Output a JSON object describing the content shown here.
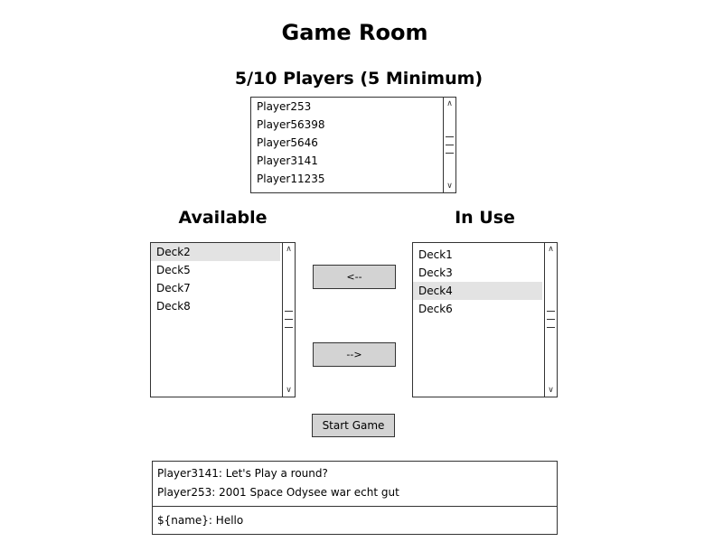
{
  "title": "Game Room",
  "players": {
    "heading": "5/10 Players (5 Minimum)",
    "items": [
      "Player253",
      "Player56398",
      "Player5646",
      "Player3141",
      "Player11235"
    ]
  },
  "available": {
    "heading": "Available",
    "items": [
      "Deck2",
      "Deck5",
      "Deck7",
      "Deck8"
    ],
    "selected": "Deck2"
  },
  "in_use": {
    "heading": "In Use",
    "items": [
      "Deck1",
      "Deck3",
      "Deck4",
      "Deck6"
    ],
    "selected": "Deck4"
  },
  "buttons": {
    "move_left": "<--",
    "move_right": "-->",
    "start_game": "Start Game"
  },
  "chat": {
    "messages": [
      "Player3141: Let's Play a round?",
      "Player253: 2001 Space Odysee war echt gut"
    ],
    "input_value": "${name}: Hello"
  }
}
